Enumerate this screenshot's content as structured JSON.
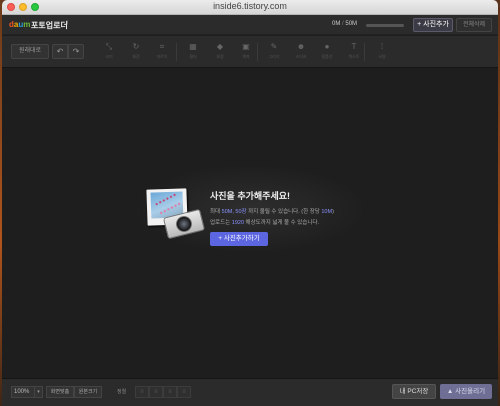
{
  "window": {
    "title": "inside6.tistory.com"
  },
  "app": {
    "logo": {
      "d": "d",
      "a": "a",
      "u": "u",
      "m": "m"
    },
    "name": "포토업로더",
    "version_mark": "ᵞ"
  },
  "quota": {
    "used": "0M",
    "sep": " / ",
    "total": "50M",
    "fraction": 0
  },
  "header_buttons": {
    "add_label": "+ 사진추가",
    "delete_all_label": "전체삭제"
  },
  "toolbar": {
    "original_label": "원래대로",
    "undo_glyph": "↶",
    "redo_glyph": "↷",
    "tools": [
      {
        "id": "resize",
        "glyph": "⤡",
        "label": "크기"
      },
      {
        "id": "rotate",
        "glyph": "↻",
        "label": "회전"
      },
      {
        "id": "crop",
        "glyph": "⌗",
        "label": "자르기"
      },
      {
        "id": "filter",
        "glyph": "▦",
        "label": "필터"
      },
      {
        "id": "correct",
        "glyph": "◆",
        "label": "보정"
      },
      {
        "id": "frame",
        "glyph": "▣",
        "label": "액자"
      },
      {
        "id": "brush",
        "glyph": "✎",
        "label": "그리기"
      },
      {
        "id": "sticker",
        "glyph": "☻",
        "label": "스티커"
      },
      {
        "id": "bubble",
        "glyph": "●",
        "label": "말풍선"
      },
      {
        "id": "text",
        "glyph": "T",
        "label": "텍스트"
      },
      {
        "id": "mosaic",
        "glyph": "⁞",
        "label": "서명"
      }
    ]
  },
  "empty_state": {
    "title": "사진을 추가해주세요!",
    "line1_a": "최대 ",
    "line1_hl1": "50M, 50장",
    "line1_b": " 까지 올릴 수 있습니다. (한 장당 ",
    "line1_hl2": "10M",
    "line1_c": ")",
    "line2_a": "업로드는 ",
    "line2_hl": "1920",
    "line2_b": " 해상도까지 넓게 볼 수 있습니다.",
    "button_label": "+ 사진추가하기"
  },
  "bottom": {
    "zoom_value": "100%",
    "zoom_arrow": "▾",
    "fit_label": "화면맞춤",
    "orig_size_label": "원본크기",
    "align_label": "정렬",
    "align_glyphs": [
      "≡",
      "≡",
      "≡",
      "≡"
    ],
    "pc_save_label": "내 PC저장",
    "upload_label": "▲ 사진올리기"
  },
  "colors": {
    "accent": "#5c66e0",
    "highlight": "#8a93ff",
    "background": "#1e1e1e"
  }
}
